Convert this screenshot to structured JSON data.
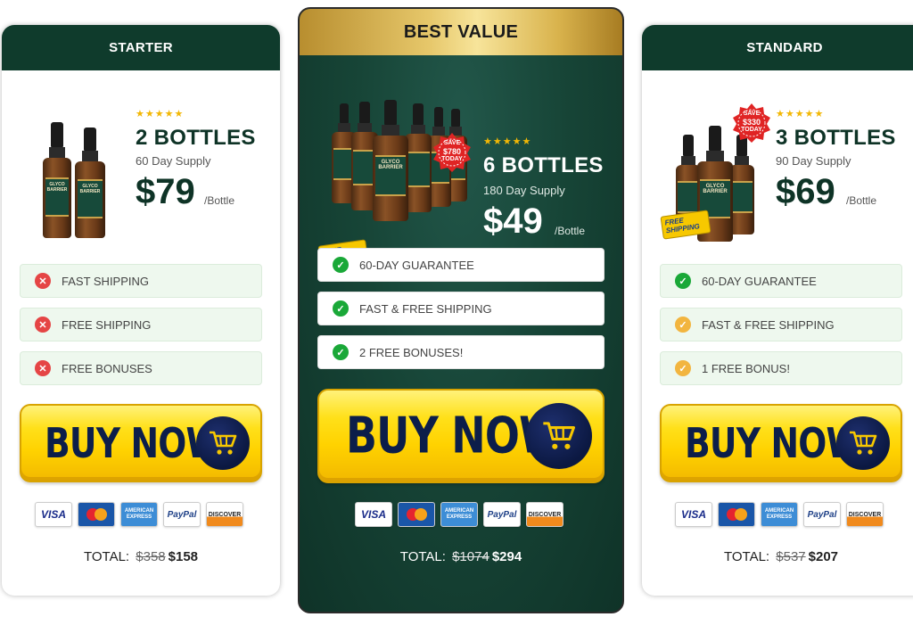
{
  "plans": [
    {
      "id": "starter",
      "header": "STARTER",
      "stars": "★★★★★",
      "quantity": "2 BOTTLES",
      "supply": "60 Day Supply",
      "price": "$79",
      "per_unit": "/Bottle",
      "bottle_label": "GLYCO BARRIER",
      "features": [
        {
          "icon": "x-icon",
          "text": "FAST SHIPPING"
        },
        {
          "icon": "x-icon",
          "text": "FREE SHIPPING"
        },
        {
          "icon": "x-icon",
          "text": "FREE BONUSES"
        }
      ],
      "buy_label": "BUY NOW",
      "total_label": "TOTAL:",
      "total_old": "$358",
      "total_new": "$158"
    },
    {
      "id": "best-value",
      "header": "BEST VALUE",
      "stars": "★★★★★",
      "quantity": "6 BOTTLES",
      "supply": "180 Day Supply",
      "price": "$49",
      "per_unit": "/Bottle",
      "bottle_label": "GLYCO BARRIER",
      "badge_save": "SAVE",
      "badge_amount": "$780",
      "badge_today": "TODAY",
      "free_shipping": "FREE SHIPPING",
      "features": [
        {
          "icon": "check-icon",
          "text": "60-DAY GUARANTEE"
        },
        {
          "icon": "check-icon",
          "text": "FAST & FREE SHIPPING"
        },
        {
          "icon": "check-icon",
          "text": "2 FREE BONUSES!"
        }
      ],
      "buy_label": "BUY NOW",
      "total_label": "TOTAL:",
      "total_old": "$1074",
      "total_new": "$294"
    },
    {
      "id": "standard",
      "header": "STANDARD",
      "stars": "★★★★★",
      "quantity": "3 BOTTLES",
      "supply": "90 Day Supply",
      "price": "$69",
      "per_unit": "/Bottle",
      "bottle_label": "GLYCO BARRIER",
      "badge_save": "SAVE",
      "badge_amount": "$330",
      "badge_today": "TODAY",
      "free_shipping": "FREE SHIPPING",
      "features": [
        {
          "icon": "check-icon",
          "text": "60-DAY GUARANTEE"
        },
        {
          "icon": "check-warn-icon",
          "text": "FAST & FREE SHIPPING"
        },
        {
          "icon": "check-warn-icon",
          "text": "1 FREE BONUS!"
        }
      ],
      "buy_label": "BUY NOW",
      "total_label": "TOTAL:",
      "total_old": "$537",
      "total_new": "$207"
    }
  ],
  "payment_methods": {
    "visa": "VISA",
    "mastercard": "MasterCard",
    "amex": "AMERICAN EXPRESS",
    "paypal": "PayPal",
    "discover": "DISCOVER"
  },
  "colors": {
    "dark_green": "#0f3b2c",
    "gold": "#e6c76a",
    "button_yellow": "#ffd200",
    "button_text": "#0c1e4a",
    "check_green": "#1aa838",
    "cross_red": "#e54545",
    "warn_orange": "#f2b53f"
  }
}
